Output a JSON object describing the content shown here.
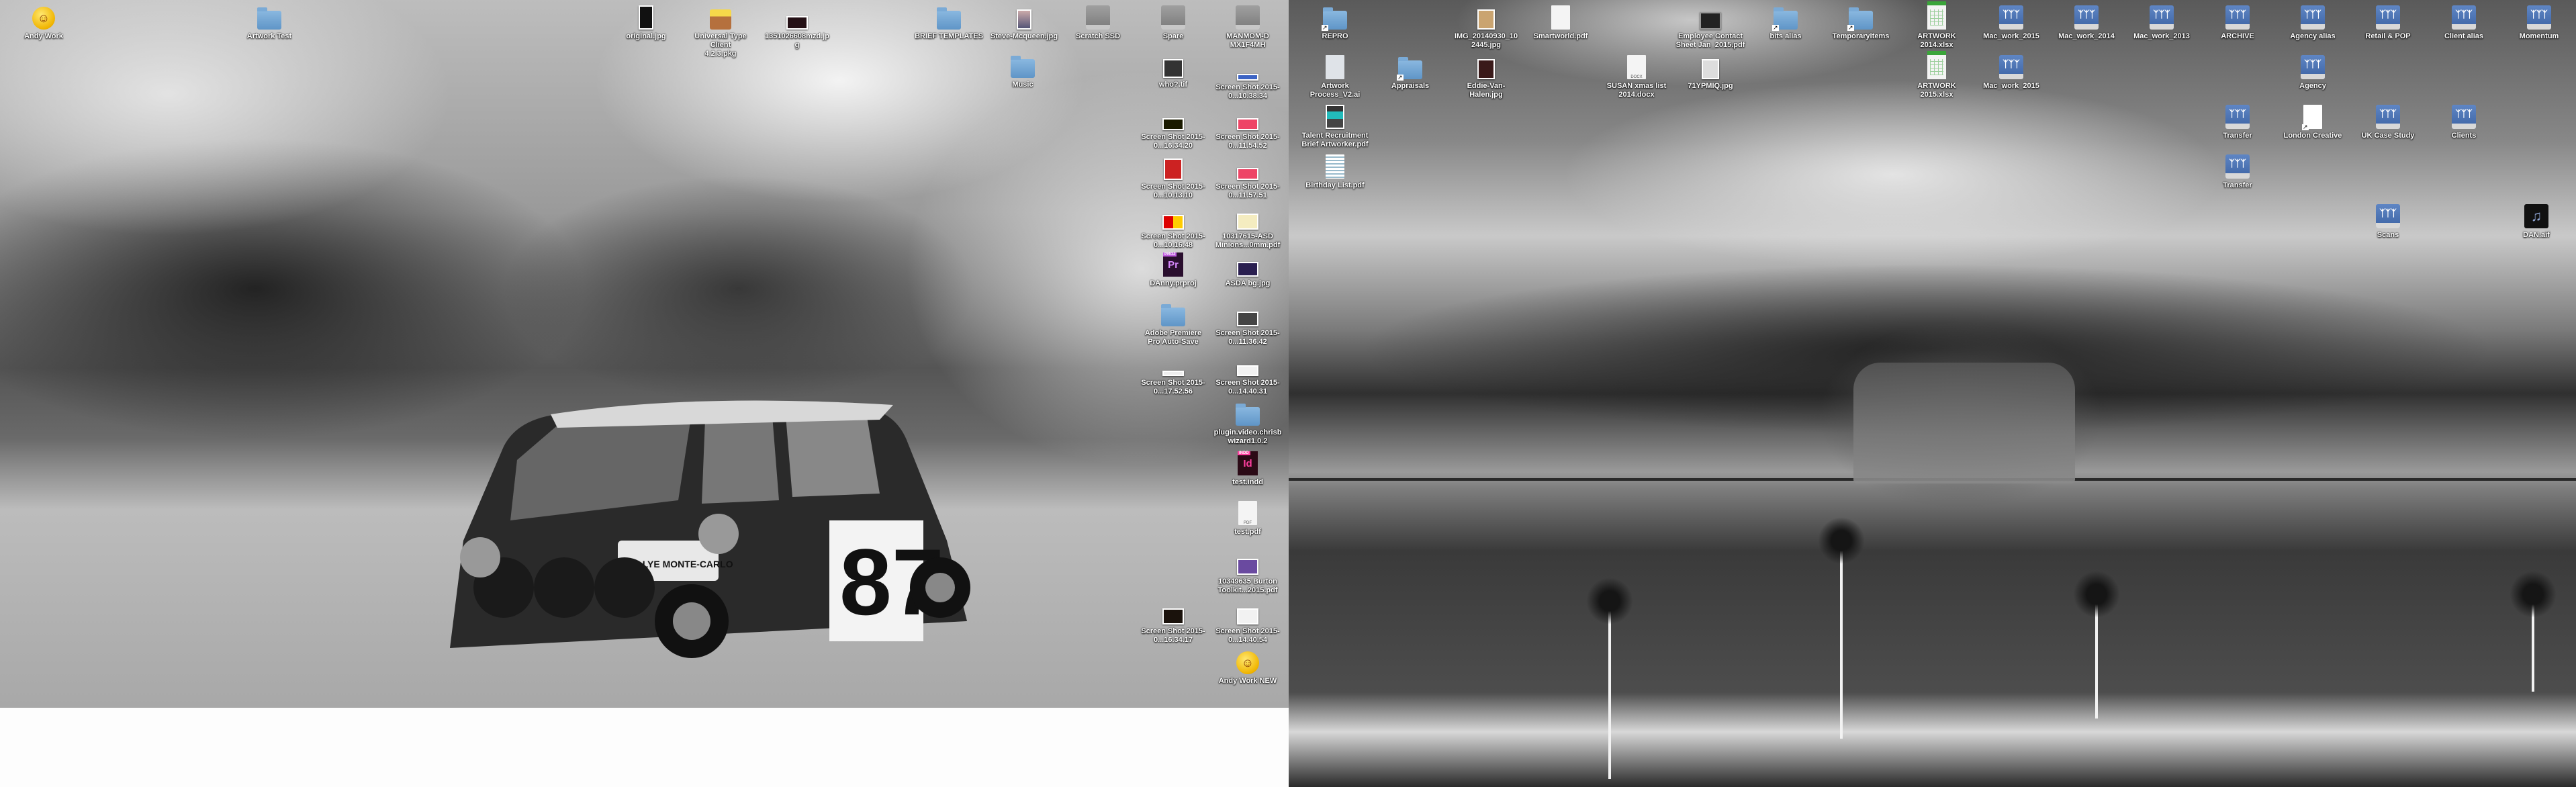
{
  "desktop": {
    "left_wallpaper": "Black-and-white photo of a Mini rally car number 87 (Rallye Monte-Carlo) on a snowy mountain road",
    "right_wallpaper": "Black-and-white photo of an atomic test explosion over a lagoon with palm trees on a beach",
    "car_plate_text": "RALLYE MONTE-CARLO",
    "car_number": "87",
    "left_icons": [
      {
        "label": "Andy Work",
        "type": "alias-smiley"
      },
      {
        "label": "Artwork Test",
        "type": "folder"
      },
      {
        "label": "original.jpg",
        "type": "image"
      },
      {
        "label": "Universal Type Client 4.2.3.pkg",
        "type": "package"
      },
      {
        "label": "1351026608mzd.jpg",
        "type": "image"
      },
      {
        "label": "BRIEF TEMPLATES",
        "type": "folder"
      },
      {
        "label": "Steve-Mcqueen.jpg",
        "type": "image"
      },
      {
        "label": "Scratch SSD",
        "type": "drive"
      },
      {
        "label": "Spare",
        "type": "drive"
      },
      {
        "label": "MANMOM-DMX1F4MH",
        "type": "drive"
      },
      {
        "label": "Music",
        "type": "folder"
      },
      {
        "label": "who?.tif",
        "type": "image"
      },
      {
        "label": "Screen Shot 2015-0...10.38.34",
        "type": "screenshot"
      },
      {
        "label": "Screen Shot 2015-0...16.34.20",
        "type": "screenshot"
      },
      {
        "label": "Screen Shot 2015-0...11.54.52",
        "type": "screenshot"
      },
      {
        "label": "Screen Shot 2015-0...10.13.10",
        "type": "screenshot"
      },
      {
        "label": "Screen Shot 2015-0...11.57.51",
        "type": "screenshot"
      },
      {
        "label": "Screen Shot 2015-0...10.16.48",
        "type": "screenshot"
      },
      {
        "label": "10317615-ASD Minions...0mm.pdf",
        "type": "pdf"
      },
      {
        "label": "DAnny.prproj",
        "type": "premiere"
      },
      {
        "label": "ASDA bg.jpg",
        "type": "image"
      },
      {
        "label": "Adobe Premiere Pro Auto-Save",
        "type": "folder"
      },
      {
        "label": "Screen Shot 2015-0...11.36.42",
        "type": "screenshot"
      },
      {
        "label": "Screen Shot 2015-0...17.52.56",
        "type": "screenshot"
      },
      {
        "label": "Screen Shot 2015-0...14.40.31",
        "type": "screenshot"
      },
      {
        "label": "plugin.video.chrisb wizard1.0.2",
        "type": "folder"
      },
      {
        "label": "test.indd",
        "type": "indesign"
      },
      {
        "label": "test.pdf",
        "type": "pdf"
      },
      {
        "label": "10349635 Burton Toolkit...2015.pdf",
        "type": "pdf"
      },
      {
        "label": "Screen Shot 2015-0...16.34.17",
        "type": "screenshot"
      },
      {
        "label": "Screen Shot 2015-0...14.40.54",
        "type": "screenshot"
      },
      {
        "label": "Andy Work NEW",
        "type": "alias-smiley"
      }
    ],
    "right_icons": [
      {
        "label": "REPRO",
        "type": "folder-alias"
      },
      {
        "label": "IMG_20140930_102445.jpg",
        "type": "image"
      },
      {
        "label": "Smartworld.pdf",
        "type": "pdf"
      },
      {
        "label": "Employee Contact Sheet Jan_2015.pdf",
        "type": "pdf"
      },
      {
        "label": "bits alias",
        "type": "folder-alias"
      },
      {
        "label": "TemporaryItems",
        "type": "folder-alias"
      },
      {
        "label": "ARTWORK 2014.xlsx",
        "type": "xlsx-alias"
      },
      {
        "label": "Mac_work_2015",
        "type": "network-drive"
      },
      {
        "label": "Mac_work_2014",
        "type": "network-drive"
      },
      {
        "label": "Mac_work_2013",
        "type": "network-drive"
      },
      {
        "label": "ARCHIVE",
        "type": "network-drive"
      },
      {
        "label": "Agency alias",
        "type": "network-drive"
      },
      {
        "label": "Retail & POP",
        "type": "network-drive"
      },
      {
        "label": "Client alias",
        "type": "network-drive"
      },
      {
        "label": "Momentum",
        "type": "network-drive"
      },
      {
        "label": "Artwork Process_V2.ai",
        "type": "ai"
      },
      {
        "label": "Appraisals",
        "type": "folder-alias"
      },
      {
        "label": "Eddie-Van-Halen.jpg",
        "type": "image"
      },
      {
        "label": "SUSAN xmas list 2014.docx",
        "type": "docx"
      },
      {
        "label": "71YPMIQ.jpg",
        "type": "image"
      },
      {
        "label": "ARTWORK 2015.xlsx",
        "type": "xlsx-alias"
      },
      {
        "label": "Mac_work_2015",
        "type": "network-drive"
      },
      {
        "label": "Agency",
        "type": "network-drive"
      },
      {
        "label": "Talent Recruitment Brief Artworker.pdf",
        "type": "pdf"
      },
      {
        "label": "Transfer",
        "type": "network-drive"
      },
      {
        "label": "London Creative",
        "type": "file-alias"
      },
      {
        "label": "UK Case Study",
        "type": "network-drive"
      },
      {
        "label": "Clients",
        "type": "network-drive"
      },
      {
        "label": "Birthday List.pdf",
        "type": "pdf"
      },
      {
        "label": "Transfer",
        "type": "network-drive"
      },
      {
        "label": "Scans",
        "type": "network-drive"
      },
      {
        "label": "DAN.aif",
        "type": "audio"
      }
    ],
    "icon_glyphs": {
      "docx_badge": "DOCX",
      "pdf_badge": "PDF",
      "xlsx_badge": "XLSX",
      "premiere_tag": "PROJ",
      "premiere_letters": "Pr",
      "indesign_tag": "INDD",
      "indesign_letters": "Id",
      "netdrive_glyph": "ᛉᛉᛉ",
      "music_glyph": "♫",
      "smiley_glyph": "☺",
      "alias_arrow": "↗"
    }
  }
}
